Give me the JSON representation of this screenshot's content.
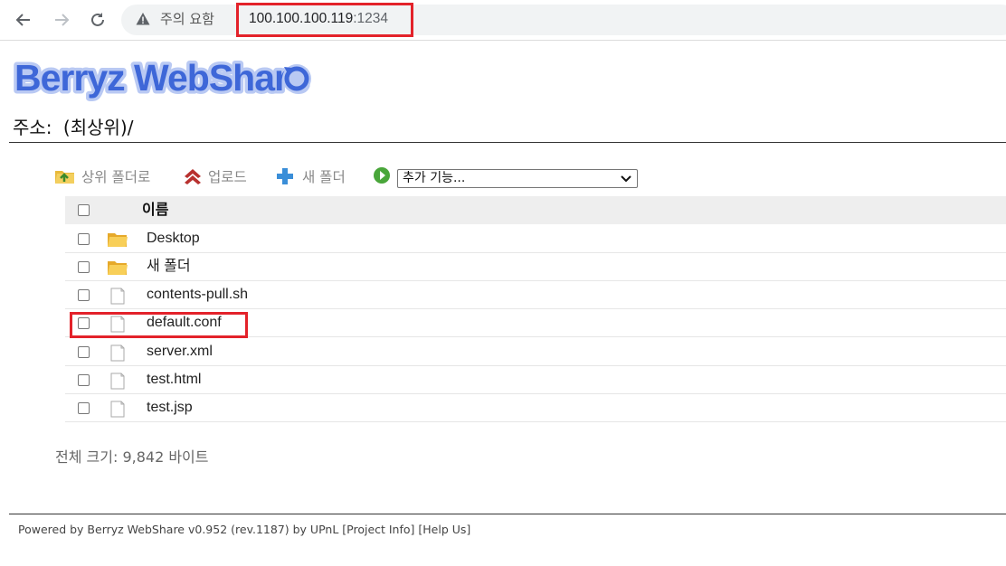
{
  "browser": {
    "security_label": "주의 요함",
    "url_host": "100.100.100.119",
    "url_port": ":1234"
  },
  "logo": {
    "text": "Berryz WebShare"
  },
  "address": {
    "label": "주소:",
    "path": "(최상위)/"
  },
  "toolbar": {
    "parent_folder": "상위 폴더로",
    "upload": "업로드",
    "new_folder": "새 폴더",
    "more_features": "추가 기능..."
  },
  "table": {
    "header_name": "이름",
    "rows": [
      {
        "name": "Desktop",
        "type": "folder"
      },
      {
        "name": "새 폴더",
        "type": "folder"
      },
      {
        "name": "contents-pull.sh",
        "type": "file"
      },
      {
        "name": "default.conf",
        "type": "file"
      },
      {
        "name": "server.xml",
        "type": "file"
      },
      {
        "name": "test.html",
        "type": "file"
      },
      {
        "name": "test.jsp",
        "type": "file"
      }
    ]
  },
  "summary": {
    "total_size": "전체 크기: 9,842 바이트"
  },
  "footer": {
    "text": "Powered by Berryz WebShare v0.952 (rev.1187) by UPnL [Project Info] [Help Us]"
  },
  "colors": {
    "highlight": "#e3222a",
    "logo_blue": "#3e67d8",
    "logo_light": "#b9c9f3"
  }
}
